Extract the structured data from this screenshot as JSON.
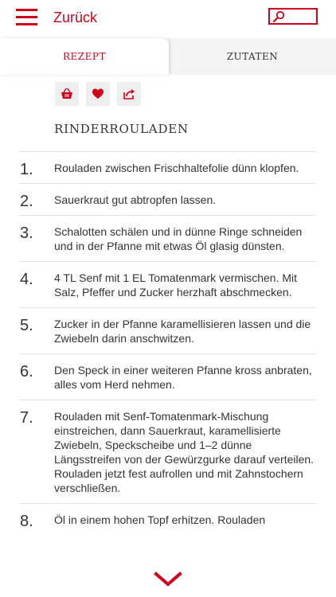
{
  "header": {
    "back_label": "Zurück"
  },
  "tabs": [
    {
      "label": "REZEPT",
      "active": true
    },
    {
      "label": "ZUTATEN",
      "active": false
    }
  ],
  "actions": {
    "icons": [
      "basket-icon",
      "heart-icon",
      "share-icon"
    ]
  },
  "recipe": {
    "title": "RINDERROULADEN",
    "steps": [
      {
        "num": "1.",
        "text": "Rouladen zwischen Frischhaltefolie dünn klopfen."
      },
      {
        "num": "2.",
        "text": "Sauerkraut gut abtropfen lassen."
      },
      {
        "num": "3.",
        "text": "Schalotten schälen und in dünne Ringe schneiden und in der Pfanne mit etwas Öl glasig dünsten."
      },
      {
        "num": "4.",
        "text": "4 TL Senf mit 1 EL Tomatenmark vermischen. Mit Salz, Pfeffer und Zucker herzhaft abschmecken."
      },
      {
        "num": "5.",
        "text": "Zucker in der Pfanne karamellisieren lassen und die Zwiebeln darin anschwitzen."
      },
      {
        "num": "6.",
        "text": "Den Speck in einer weiteren Pfanne kross anbraten, alles vom Herd nehmen."
      },
      {
        "num": "7.",
        "text": "Rouladen mit Senf-Tomatenmark-Mischung einstreichen, dann Sauerkraut, karamellisierte Zwiebeln, Speckscheibe und 1–2 dünne Längsstreifen von der Gewürzgurke darauf verteilen. Rouladen jetzt fest aufrollen und mit Zahnstochern verschließen."
      },
      {
        "num": "8.",
        "text": "Öl in einem hohen Topf erhitzen. Rouladen"
      }
    ]
  },
  "colors": {
    "accent": "#d0021b",
    "tab_bg": "#f4f4f4",
    "button_bg": "#eeeeee",
    "divider": "#e2e2e2",
    "text": "#333333"
  }
}
